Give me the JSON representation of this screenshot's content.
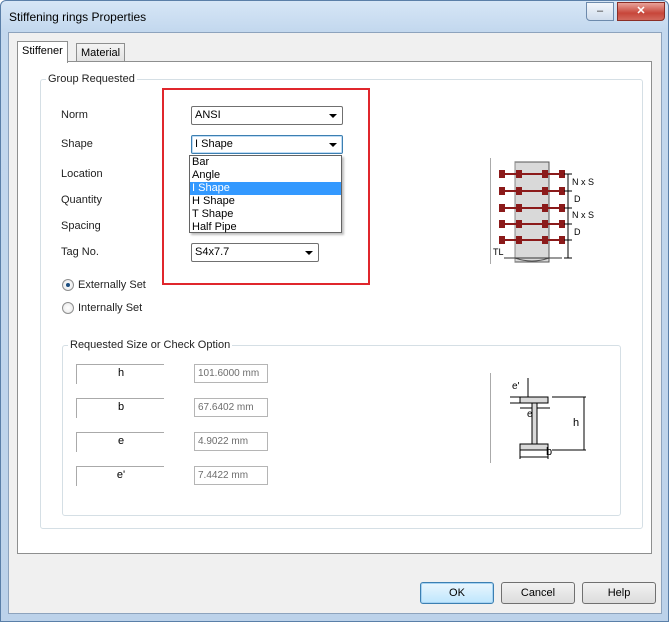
{
  "window": {
    "title": "Stiffening rings Properties",
    "caption_buttons": {
      "minimize": "–",
      "maximize": "☐",
      "close": "✕"
    }
  },
  "tabs": [
    {
      "label": "Stiffener",
      "active": true
    },
    {
      "label": "Material",
      "active": false
    }
  ],
  "group_requested": {
    "title": "Group Requested",
    "norm": {
      "label": "Norm",
      "value": "ANSI"
    },
    "shape": {
      "label": "Shape",
      "value": "I Shape",
      "options": [
        "Bar",
        "Angle",
        "I Shape",
        "H Shape",
        "T Shape",
        "Half Pipe"
      ],
      "selected_index": 2
    },
    "location": {
      "label": "Location"
    },
    "quantity": {
      "label": "Quantity"
    },
    "spacing": {
      "label": "Spacing"
    },
    "tag_no": {
      "label": "Tag No.",
      "value": "S4x7.7"
    },
    "radios": [
      {
        "label": "Externally Set",
        "checked": true
      },
      {
        "label": "Internally Set",
        "checked": false
      }
    ],
    "diagram_labels": {
      "nxs": "N x S",
      "d": "D",
      "tl": "TL"
    }
  },
  "requested_size": {
    "title": "Requested Size or Check Option",
    "fields": [
      {
        "name": "h",
        "value": "101.6000 mm"
      },
      {
        "name": "b",
        "value": "67.6402 mm"
      },
      {
        "name": "e",
        "value": "4.9022 mm"
      },
      {
        "name": "e'",
        "value": "7.4422 mm"
      }
    ],
    "diagram_labels": {
      "e_prime": "e'",
      "e": "e",
      "h": "h",
      "b": "b"
    }
  },
  "buttons": {
    "ok": "OK",
    "cancel": "Cancel",
    "help": "Help"
  },
  "colors": {
    "highlight": "#e0262c",
    "selection": "#3399ff"
  }
}
